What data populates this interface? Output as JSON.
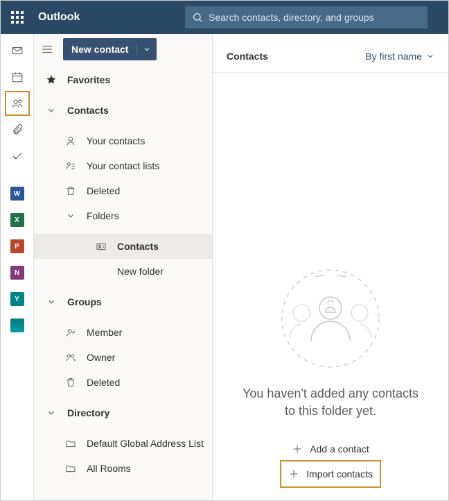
{
  "header": {
    "brand": "Outlook",
    "search_placeholder": "Search contacts, directory, and groups"
  },
  "toolbar": {
    "new_contact": "New contact"
  },
  "rail": {
    "items": [
      {
        "name": "mail-icon"
      },
      {
        "name": "calendar-icon"
      },
      {
        "name": "people-icon",
        "selected": true
      },
      {
        "name": "attachment-icon"
      },
      {
        "name": "todo-icon"
      },
      {
        "name": "word-app",
        "letter": "W",
        "cls": "w"
      },
      {
        "name": "excel-app",
        "letter": "X",
        "cls": "x"
      },
      {
        "name": "powerpoint-app",
        "letter": "P",
        "cls": "p"
      },
      {
        "name": "onenote-app",
        "letter": "N",
        "cls": "n"
      },
      {
        "name": "yammer-app",
        "letter": "Y",
        "cls": "y"
      },
      {
        "name": "apps-app",
        "letter": "",
        "cls": "s"
      }
    ]
  },
  "nav": {
    "favorites": "Favorites",
    "contacts_header": "Contacts",
    "your_contacts": "Your contacts",
    "your_contact_lists": "Your contact lists",
    "deleted": "Deleted",
    "folders": "Folders",
    "folder_contacts": "Contacts",
    "new_folder": "New folder",
    "groups_header": "Groups",
    "member": "Member",
    "owner": "Owner",
    "groups_deleted": "Deleted",
    "directory_header": "Directory",
    "default_gal": "Default Global Address List",
    "all_rooms": "All Rooms"
  },
  "main": {
    "title": "Contacts",
    "sort": "By first name",
    "empty_line1": "You haven't added any contacts",
    "empty_line2": "to this folder yet.",
    "add_contact": "Add a contact",
    "import_contacts": "Import contacts"
  }
}
